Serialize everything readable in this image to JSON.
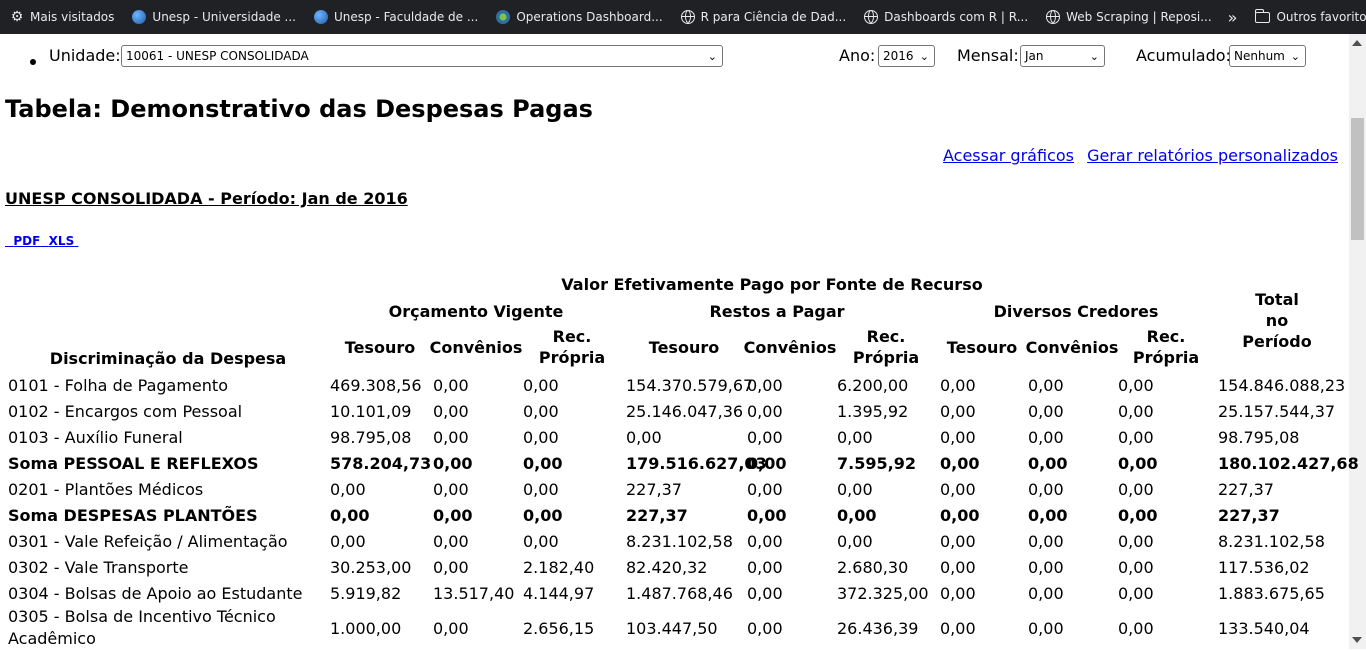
{
  "bookmarks": [
    {
      "label": "Mais visitados",
      "icon": "gear-icon"
    },
    {
      "label": "Unesp - Universidade ...",
      "icon": "earth-icon"
    },
    {
      "label": "Unesp - Faculdade de ...",
      "icon": "earth-icon"
    },
    {
      "label": "Operations Dashboard...",
      "icon": "dashboard-icon"
    },
    {
      "label": "R para Ciência de Dad...",
      "icon": "globe-icon"
    },
    {
      "label": "Dashboards com R | R...",
      "icon": "globe-icon"
    },
    {
      "label": "Web Scraping | Reposi...",
      "icon": "globe-icon"
    }
  ],
  "other_bookmarks": "Outros favoritos",
  "filters": {
    "unidade_label": "Unidade:",
    "unidade_value": "10061 - UNESP CONSOLIDADA",
    "ano_label": "Ano:",
    "ano_value": "2016",
    "mensal_label": "Mensal:",
    "mensal_value": "Jan",
    "acumulado_label": "Acumulado:",
    "acumulado_value": "Nenhum"
  },
  "page_title": "Tabela: Demonstrativo das Despesas Pagas",
  "links": {
    "graficos": "Acessar gráficos",
    "relatorios": "Gerar relatórios personalizados"
  },
  "subtitle": "UNESP CONSOLIDADA - Período: Jan de 2016",
  "export": {
    "pdf": "PDF",
    "xls": "XLS"
  },
  "table": {
    "header_main": "Valor Efetivamente Pago por Fonte de Recurso",
    "groups": [
      "Orçamento Vigente",
      "Restos a Pagar",
      "Diversos Credores"
    ],
    "total_header": [
      "Total",
      "no",
      "Período"
    ],
    "desc_header": "Discriminação da Despesa",
    "sub": {
      "tesouro": "Tesouro",
      "convenios": "Convênios",
      "rec1": "Rec.",
      "rec2": "Própria"
    },
    "rows": [
      {
        "bold": false,
        "cells": [
          "0101 - Folha de Pagamento",
          "469.308,56",
          "0,00",
          "0,00",
          "154.370.579,67",
          "0,00",
          "6.200,00",
          "0,00",
          "0,00",
          "0,00",
          "154.846.088,23"
        ]
      },
      {
        "bold": false,
        "cells": [
          "0102 - Encargos com Pessoal",
          "10.101,09",
          "0,00",
          "0,00",
          "25.146.047,36",
          "0,00",
          "1.395,92",
          "0,00",
          "0,00",
          "0,00",
          "25.157.544,37"
        ]
      },
      {
        "bold": false,
        "cells": [
          "0103 - Auxílio Funeral",
          "98.795,08",
          "0,00",
          "0,00",
          "0,00",
          "0,00",
          "0,00",
          "0,00",
          "0,00",
          "0,00",
          "98.795,08"
        ]
      },
      {
        "bold": true,
        "cells": [
          "Soma PESSOAL E REFLEXOS",
          "578.204,73",
          "0,00",
          "0,00",
          "179.516.627,03",
          "0,00",
          "7.595,92",
          "0,00",
          "0,00",
          "0,00",
          "180.102.427,68"
        ]
      },
      {
        "bold": false,
        "cells": [
          "0201 - Plantões Médicos",
          "0,00",
          "0,00",
          "0,00",
          "227,37",
          "0,00",
          "0,00",
          "0,00",
          "0,00",
          "0,00",
          "227,37"
        ]
      },
      {
        "bold": true,
        "cells": [
          "Soma DESPESAS PLANTÕES",
          "0,00",
          "0,00",
          "0,00",
          "227,37",
          "0,00",
          "0,00",
          "0,00",
          "0,00",
          "0,00",
          "227,37"
        ]
      },
      {
        "bold": false,
        "cells": [
          "0301 - Vale Refeição / Alimentação",
          "0,00",
          "0,00",
          "0,00",
          "8.231.102,58",
          "0,00",
          "0,00",
          "0,00",
          "0,00",
          "0,00",
          "8.231.102,58"
        ]
      },
      {
        "bold": false,
        "cells": [
          "0302 - Vale Transporte",
          "30.253,00",
          "0,00",
          "2.182,40",
          "82.420,32",
          "0,00",
          "2.680,30",
          "0,00",
          "0,00",
          "0,00",
          "117.536,02"
        ]
      },
      {
        "bold": false,
        "cells": [
          "0304 - Bolsas de Apoio ao Estudante",
          "5.919,82",
          "13.517,40",
          "4.144,97",
          "1.487.768,46",
          "0,00",
          "372.325,00",
          "0,00",
          "0,00",
          "0,00",
          "1.883.675,65"
        ]
      },
      {
        "bold": false,
        "tall": true,
        "cells": [
          "0305 - Bolsa de Incentivo Técnico|Acadêmico",
          "1.000,00",
          "0,00",
          "2.656,15",
          "103.447,50",
          "0,00",
          "26.436,39",
          "0,00",
          "0,00",
          "0,00",
          "133.540,04"
        ]
      }
    ]
  }
}
